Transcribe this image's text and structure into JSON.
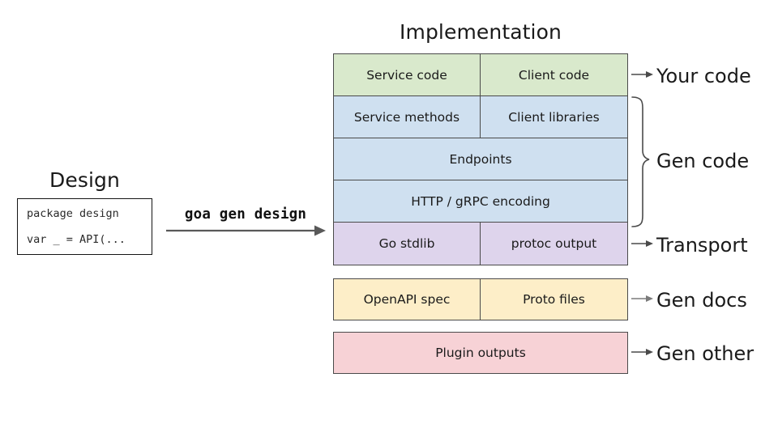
{
  "diagram": {
    "design": {
      "title": "Design",
      "code_lines": [
        "package design",
        "var _ = API(..."
      ]
    },
    "transform": {
      "command_label": "goa gen design",
      "arrow_icon": "arrow-right-icon"
    },
    "implementation": {
      "title": "Implementation",
      "bands": [
        {
          "group": "your-code",
          "color": "#d9e9cc",
          "cells": [
            "Service code",
            "Client code"
          ]
        },
        {
          "group": "gen-code",
          "color": "#cfe0f0",
          "cells": [
            "Service methods",
            "Client libraries"
          ]
        },
        {
          "group": "gen-code",
          "color": "#cfe0f0",
          "cells": [
            "Endpoints"
          ]
        },
        {
          "group": "gen-code",
          "color": "#cfe0f0",
          "cells": [
            "HTTP / gRPC encoding"
          ]
        },
        {
          "group": "transport",
          "color": "#ded4ec",
          "cells": [
            "Go stdlib",
            "protoc output"
          ]
        }
      ],
      "standalone": [
        {
          "group": "gen-docs",
          "color": "#fdeec8",
          "cells": [
            "OpenAPI spec",
            "Proto files"
          ]
        },
        {
          "group": "gen-other",
          "color": "#f7d2d6",
          "cells": [
            "Plugin outputs"
          ]
        }
      ]
    },
    "callouts": [
      {
        "label": "Your code",
        "connector": "arrow-right-icon"
      },
      {
        "label": "Gen code",
        "connector": "curly-brace-icon"
      },
      {
        "label": "Transport",
        "connector": "arrow-right-icon"
      },
      {
        "label": "Gen docs",
        "connector": "arrow-right-icon"
      },
      {
        "label": "Gen other",
        "connector": "arrow-right-icon"
      }
    ]
  }
}
